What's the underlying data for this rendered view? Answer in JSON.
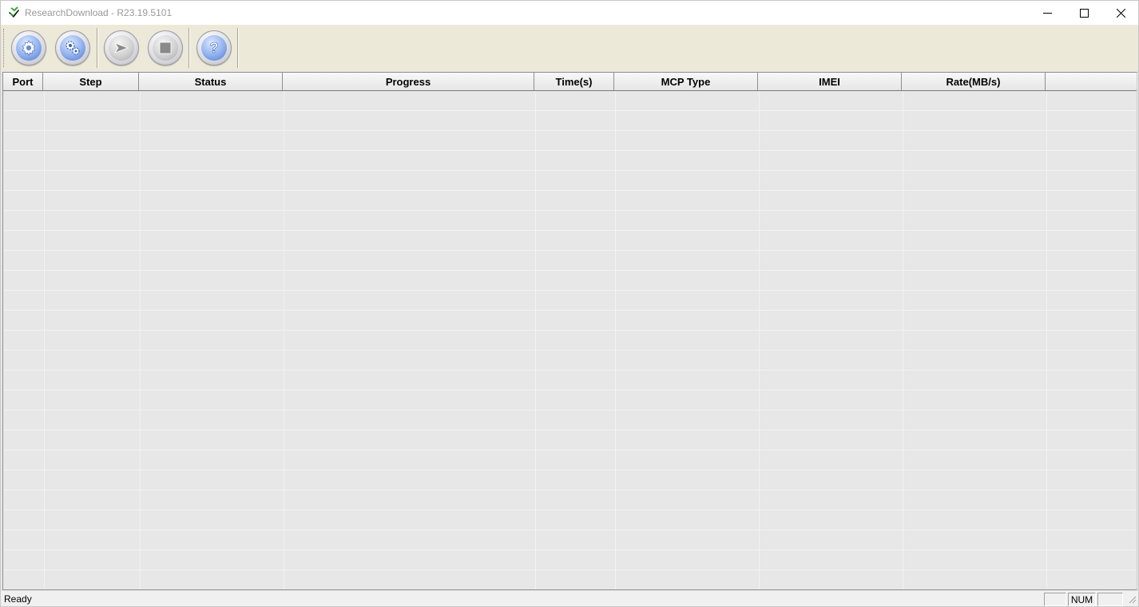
{
  "window": {
    "title": "ResearchDownload - R23.19.5101",
    "controls": [
      "minimize",
      "maximize",
      "close"
    ]
  },
  "toolbar": {
    "buttons": [
      {
        "name": "load-packet",
        "icon": "gear-icon"
      },
      {
        "name": "settings",
        "icon": "gears-icon"
      },
      {
        "name": "start-download",
        "icon": "play-arrow-icon"
      },
      {
        "name": "stop-download",
        "icon": "stop-square-icon"
      },
      {
        "name": "help",
        "icon": "question-mark-icon"
      }
    ]
  },
  "table": {
    "columns": [
      "Port",
      "Step",
      "Status",
      "Progress",
      "Time(s)",
      "MCP Type",
      "IMEI",
      "Rate(MB/s)"
    ],
    "rows": []
  },
  "statusbar": {
    "text": "Ready",
    "panes": [
      "",
      "NUM",
      ""
    ]
  },
  "colors": {
    "toolbar_bg": "#ece9d8",
    "grid_bg": "#e7e7e7",
    "button_accent": "#4c78cc"
  }
}
